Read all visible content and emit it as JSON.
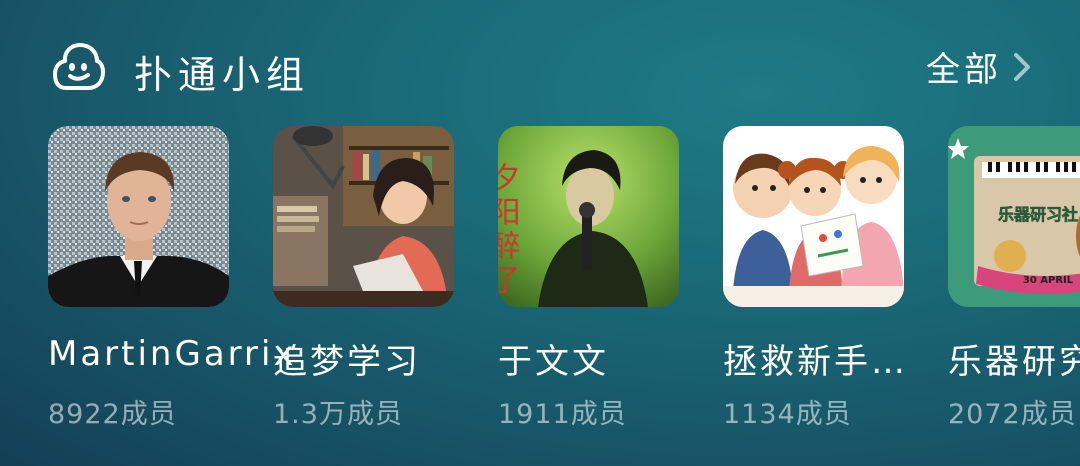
{
  "header": {
    "title": "扑通小组",
    "all_label": "全部"
  },
  "icons": {
    "logo": "cloud-face-icon",
    "more": "chevron-right-icon"
  },
  "colors": {
    "accent_bg": "#1a6a78",
    "text_primary": "#ffffff",
    "text_secondary": "rgba(255,255,255,0.55)"
  },
  "groups": [
    {
      "name": "MartinGarrix",
      "members": "8922成员"
    },
    {
      "name": "追梦学习",
      "members": "1.3万成员"
    },
    {
      "name": "于文文",
      "members": "1911成员",
      "cover_text": "夕阳醉了"
    },
    {
      "name": "拯救新手…",
      "members": "1134成员"
    },
    {
      "name": "乐器研究",
      "members": "2072成员",
      "cover_text": "乐器研习社",
      "cover_badge": "30 APRIL"
    }
  ]
}
